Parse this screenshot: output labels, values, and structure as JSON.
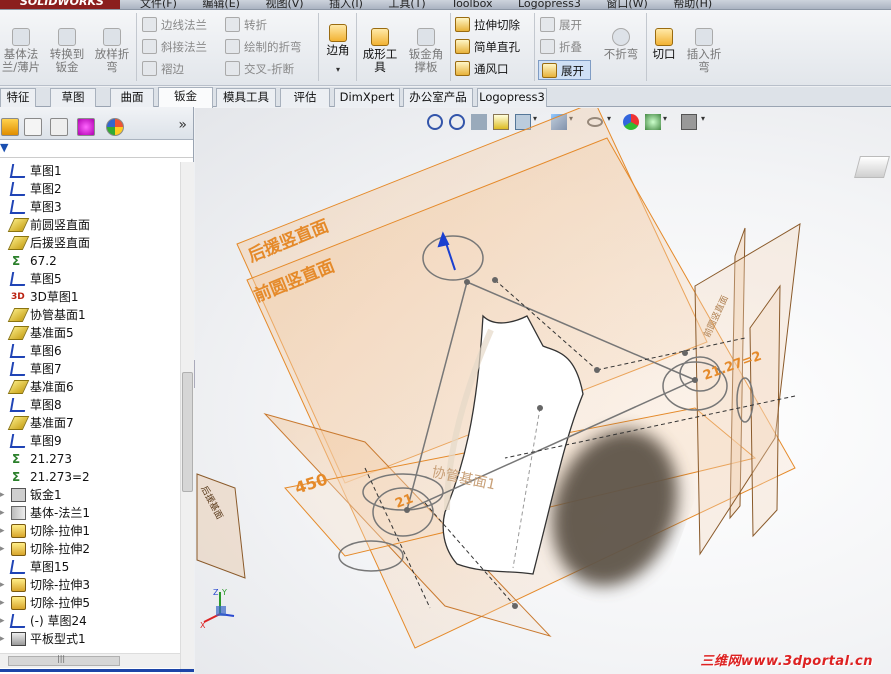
{
  "app": {
    "logo": "SOLIDWORKS",
    "menus": [
      "文件(F)",
      "编辑(E)",
      "视图(V)",
      "插入(I)",
      "工具(T)",
      "Toolbox",
      "Logopress3",
      "窗口(W)",
      "帮助(H)"
    ]
  },
  "ribbon": {
    "big": [
      {
        "label": "基体法\n兰/薄片",
        "active": false
      },
      {
        "label": "转换到\n钣金",
        "active": false
      },
      {
        "label": "放样折\n弯",
        "active": false
      },
      {
        "label": "边角",
        "active": true
      },
      {
        "label": "成形工\n具",
        "active": true
      },
      {
        "label": "钣金角\n撑板",
        "active": false
      },
      {
        "label": "切口",
        "active": true
      },
      {
        "label": "插入折\n弯",
        "active": false
      }
    ],
    "small": [
      {
        "label": "边线法兰",
        "active": false
      },
      {
        "label": "斜接法兰",
        "active": false
      },
      {
        "label": "褶边",
        "active": false
      },
      {
        "label": "转折",
        "active": false
      },
      {
        "label": "绘制的折弯",
        "active": false
      },
      {
        "label": "交叉-折断",
        "active": false
      },
      {
        "label": "拉伸切除",
        "active": true
      },
      {
        "label": "简单直孔",
        "active": true
      },
      {
        "label": "通风口",
        "active": true
      },
      {
        "label": "展开",
        "active": false
      },
      {
        "label": "折叠",
        "active": false
      },
      {
        "label": "展开",
        "active": true,
        "selected": true
      },
      {
        "label": "不折弯",
        "active": false
      }
    ]
  },
  "tabs": [
    {
      "label": "特征",
      "active": false
    },
    {
      "label": "草图",
      "active": false
    },
    {
      "label": "曲面",
      "active": false
    },
    {
      "label": "钣金",
      "active": true
    },
    {
      "label": "模具工具",
      "active": false
    },
    {
      "label": "评估",
      "active": false
    },
    {
      "label": "DimXpert",
      "active": false
    },
    {
      "label": "办公室产品",
      "active": false
    },
    {
      "label": "Logopress3",
      "active": false
    }
  ],
  "tree": {
    "items": [
      {
        "label": "草图1",
        "icon": "sketch-icon"
      },
      {
        "label": "草图2",
        "icon": "sketch-icon"
      },
      {
        "label": "草图3",
        "icon": "sketch-icon"
      },
      {
        "label": "前圆竖直面",
        "icon": "plane-icon"
      },
      {
        "label": "后援竖直面",
        "icon": "plane-icon"
      },
      {
        "label": "67.2",
        "icon": "dimension-icon"
      },
      {
        "label": "草图5",
        "icon": "sketch-icon"
      },
      {
        "label": "3D草图1",
        "icon": "sketch3d-icon"
      },
      {
        "label": "协管基面1",
        "icon": "plane-icon"
      },
      {
        "label": "基准面5",
        "icon": "plane-icon"
      },
      {
        "label": "草图6",
        "icon": "sketch-icon"
      },
      {
        "label": "草图7",
        "icon": "sketch-icon"
      },
      {
        "label": "基准面6",
        "icon": "plane-icon"
      },
      {
        "label": "草图8",
        "icon": "sketch-icon"
      },
      {
        "label": "基准面7",
        "icon": "plane-icon"
      },
      {
        "label": "草图9",
        "icon": "sketch-icon"
      },
      {
        "label": "21.273",
        "icon": "dimension-icon"
      },
      {
        "label": "21.273=2",
        "icon": "dimension-icon"
      },
      {
        "label": "钣金1",
        "icon": "sheetmetal-icon",
        "toggle": true
      },
      {
        "label": "基体-法兰1",
        "icon": "flange-icon",
        "toggle": true
      },
      {
        "label": "切除-拉伸1",
        "icon": "cut-extrude-icon",
        "toggle": true
      },
      {
        "label": "切除-拉伸2",
        "icon": "cut-extrude-icon",
        "toggle": true
      },
      {
        "label": "草图15",
        "icon": "sketch-icon"
      },
      {
        "label": "切除-拉伸3",
        "icon": "cut-extrude-icon",
        "toggle": true
      },
      {
        "label": "切除-拉伸5",
        "icon": "cut-extrude-icon",
        "toggle": true
      },
      {
        "label": "(-) 草图24",
        "icon": "sketch-icon",
        "toggle": true
      },
      {
        "label": "平板型式1",
        "icon": "flat-pattern-icon",
        "toggle": true
      }
    ]
  },
  "viewport": {
    "labels": {
      "plane_back": "后援竖直面",
      "plane_front": "前圆竖直面",
      "dim_450": "450",
      "dim_2127": "21.27=2",
      "dim_21": "21",
      "plane_pipe": "协管基面1",
      "plane_left": "后援基面",
      "plane_right": "前圆竖直面"
    },
    "watermark": "三维网www.3dportal.cn",
    "colors": {
      "plane": "#e58a2a",
      "part": "#ffffff",
      "sketch": "#777777",
      "shadow": "#5e5448"
    }
  }
}
